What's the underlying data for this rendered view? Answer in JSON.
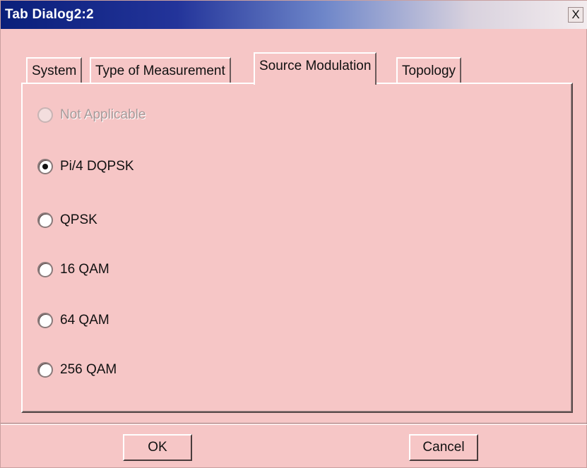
{
  "window": {
    "title": "Tab Dialog2:2",
    "close_label": "X"
  },
  "tabs": [
    {
      "label": "System",
      "selected": false
    },
    {
      "label": "Type of Measurement",
      "selected": false
    },
    {
      "label": "Source Modulation",
      "selected": true
    },
    {
      "label": "Topology",
      "selected": false
    }
  ],
  "options": [
    {
      "label": "Not Applicable",
      "checked": false,
      "enabled": false
    },
    {
      "label": "Pi/4 DQPSK",
      "checked": true,
      "enabled": true
    },
    {
      "label": "QPSK",
      "checked": false,
      "enabled": true
    },
    {
      "label": "16 QAM",
      "checked": false,
      "enabled": true
    },
    {
      "label": "64 QAM",
      "checked": false,
      "enabled": true
    },
    {
      "label": "256 QAM",
      "checked": false,
      "enabled": true
    }
  ],
  "buttons": {
    "ok": "OK",
    "cancel": "Cancel"
  },
  "colors": {
    "background": "#f6c6c6",
    "title_start": "#0a1f7a",
    "title_end": "#f3ecee"
  }
}
